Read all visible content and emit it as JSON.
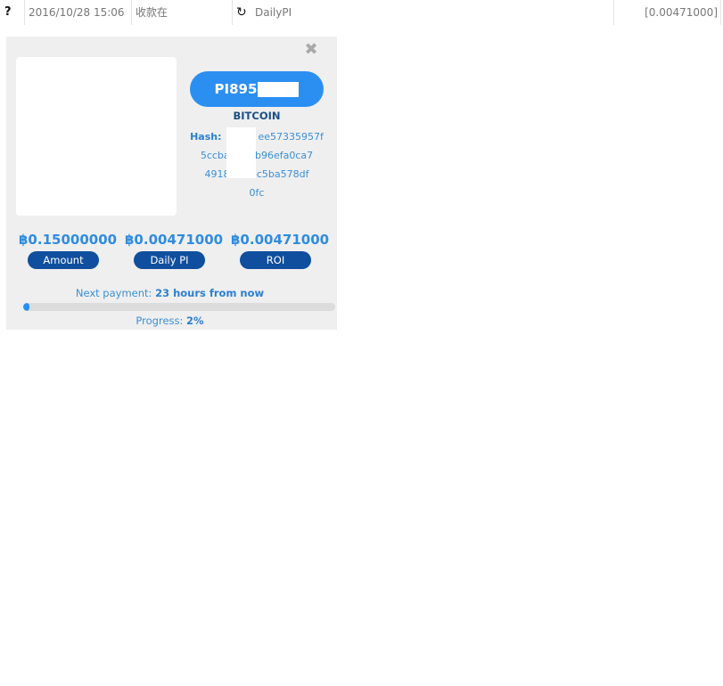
{
  "top_row": {
    "help_glyph": "?",
    "datetime": "2016/10/28 15:06",
    "status": "收款在",
    "type_icon": "refresh-icon",
    "type": "DailyPI",
    "amount": "[0.00471000]"
  },
  "panel": {
    "close_icon": "close-icon",
    "plan_id_visible": "PI895",
    "coin": "BITCOIN",
    "hash_label": "Hash:",
    "hash_lines": [
      "ee57335957f",
      "5ccbaf9 37b96efa0ca7",
      "4918ca 56c5ba578df",
      "0fc"
    ],
    "stats": [
      {
        "value": "฿0.15000000",
        "label": "Amount"
      },
      {
        "value": "฿0.00471000",
        "label": "Daily PI"
      },
      {
        "value": "฿0.00471000",
        "label": "ROI"
      }
    ],
    "next_payment_label": "Next payment:",
    "next_payment_value": "23 hours from now",
    "progress_label": "Progress:",
    "progress_value": "2%",
    "progress_fraction": 0.02,
    "accent_color": "#2b8ff1",
    "dark_pill_color": "#0f4f9e"
  }
}
